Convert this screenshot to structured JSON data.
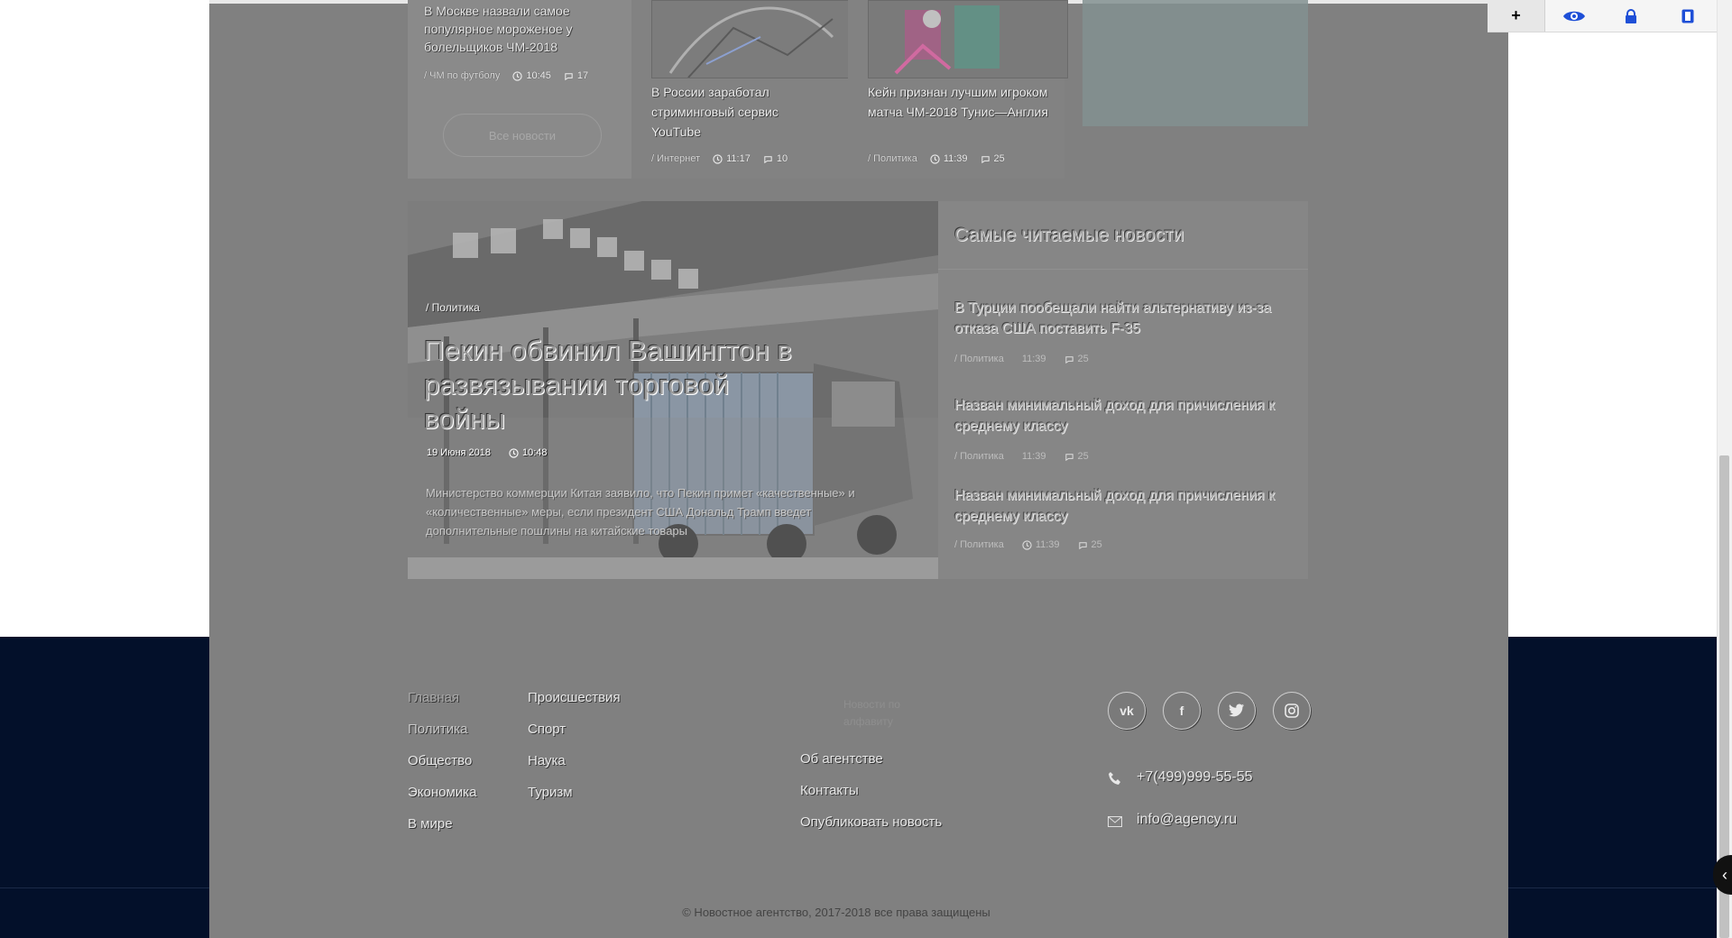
{
  "top_cards": {
    "col1": {
      "title": "В Москве назвали самое популярное мороженое у болельщиков ЧМ-2018",
      "category": "/ ЧМ по футболу",
      "time": "10:45",
      "comments": "17",
      "more_button": "Все новости"
    },
    "col2": {
      "title": "В России заработал стриминговый сервис YouTube",
      "category": "/ Интернет",
      "time": "11:17",
      "comments": "10"
    },
    "col3": {
      "title": "Кейн признан лучшим игроком матча ЧМ-2018 Тунис—Англия",
      "category": "/ Политика",
      "time": "11:39",
      "comments": "25"
    }
  },
  "hero": {
    "category": "/ Политика",
    "title": "Пекин обвинил Вашингтон в развязывании торговой войны",
    "date": "19 Июня 2018",
    "time": "10:48",
    "description": "Министерство коммерции Китая заявило, что Пекин примет «качественные» и «количественные» меры, если президент США Дональд Трамп введет дополнительные пошлины на китайские товары"
  },
  "most_read": {
    "heading": "Самые читаемые новости",
    "items": [
      {
        "title": "В Турции пообещали найти альтернативу из-за отказа США поставить F-35",
        "category": "/ Политика",
        "time": "11:39",
        "comments": "25"
      },
      {
        "title": "Назван минимальный доход для причисления к среднему классу",
        "category": "/ Политика",
        "time": "11:39",
        "comments": "25"
      },
      {
        "title": "Назван минимальный доход для причисления к среднему классу",
        "category": "/ Политика",
        "time": "11:39",
        "comments": "25"
      }
    ]
  },
  "footer": {
    "nav_col1": [
      "Главная",
      "Политика",
      "Общество",
      "Экономика",
      "В мире"
    ],
    "nav_col2": [
      "Происшествия",
      "Спорт",
      "Наука",
      "Туризм"
    ],
    "nav_col3_faint": "Новости по алфавиту",
    "nav_col3": [
      "Об агентстве",
      "Контакты",
      "Опубликовать новость"
    ],
    "social": [
      "vk-icon",
      "facebook-icon",
      "twitter-icon",
      "instagram-icon"
    ],
    "phone": "+7(499)999-55-55",
    "email": "info@agency.ru",
    "copyright": "© Новостное агентство, 2017-2018 все права защищены"
  },
  "toolbar": {
    "buttons": [
      "+",
      "eye-icon",
      "lock-icon",
      "bookmark-icon"
    ]
  },
  "colors": {
    "footer_bg": "#03102a",
    "overlay_gray": "#808080",
    "toolbar_accent": "#1e4fd7"
  }
}
